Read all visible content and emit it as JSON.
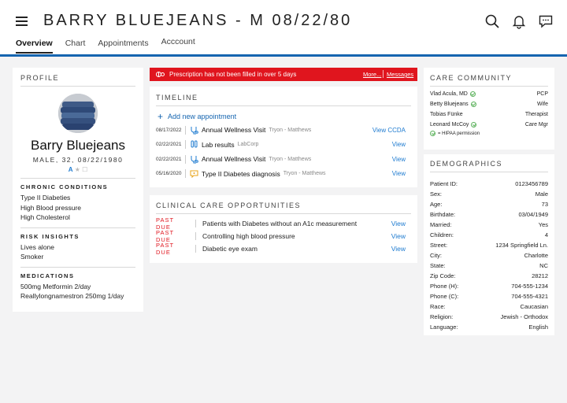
{
  "header": {
    "title": "BARRY BLUEJEANS - M 08/22/80",
    "tabs": [
      {
        "label": "Overview"
      },
      {
        "label": "Chart"
      },
      {
        "label": "Appointments"
      },
      {
        "label": "Acccount"
      }
    ],
    "icons": [
      "search-icon",
      "bell-icon",
      "chat-icon"
    ]
  },
  "profile": {
    "section_title": "PROFILE",
    "name": "Barry Bluejeans",
    "info": "MALE, 32, 08/22/1980",
    "badges": [
      "A",
      "★",
      "☐"
    ],
    "chronic": {
      "title": "CHRONIC CONDITIONS",
      "items": [
        "Type II Diabeties",
        "High Blood pressure",
        "High Cholesterol"
      ]
    },
    "risk": {
      "title": "RISK INSIGHTS",
      "items": [
        "Lives alone",
        "Smoker"
      ]
    },
    "meds": {
      "title": "MEDICATIONS",
      "items": [
        "500mg Metformin 2/day",
        "Reallylongnamestron 250mg 1/day"
      ]
    }
  },
  "alert": {
    "text": "Prescription has not been filled in over 5 days",
    "more": "More...",
    "messages": "Messages",
    "color": "#e0151e"
  },
  "timeline": {
    "title": "TIMELINE",
    "add_label": "Add new appointment",
    "rows": [
      {
        "date": "08/17/2022",
        "icon": "stethoscope-icon",
        "title": "Annual Wellness Visit",
        "sub": "Tryon - Matthews",
        "action": "View CCDA"
      },
      {
        "date": "02/22/2021",
        "icon": "lab-tubes-icon",
        "title": "Lab results",
        "sub": "LabCorp",
        "action": "View"
      },
      {
        "date": "02/22/2021",
        "icon": "stethoscope-icon",
        "title": "Annual Wellness Visit",
        "sub": "Tryon - Matthews",
        "action": "View"
      },
      {
        "date": "05/16/2020",
        "icon": "diagnosis-bubble-icon",
        "title": "Type II Diabetes diagnosis",
        "sub": "Tryon - Matthews",
        "action": "View"
      }
    ]
  },
  "clinical": {
    "title": "CLINICAL CARE OPPORTUNITIES",
    "rows": [
      {
        "status": "PAST DUE",
        "text": "Patients with Diabetes without an A1c measurement",
        "action": "View"
      },
      {
        "status": "PAST DUE",
        "text": "Controlling high blood pressure",
        "action": "View"
      },
      {
        "status": "PAST DUE",
        "text": "Diabetic eye exam",
        "action": "View"
      }
    ]
  },
  "care": {
    "title": "CARE COMMUNITY",
    "rows": [
      {
        "name": "Vlad Acula, MD",
        "role": "PCP",
        "hipaa": true
      },
      {
        "name": "Betty Bluejeans",
        "role": "Wife",
        "hipaa": true
      },
      {
        "name": "Tobias Fünke",
        "role": "Therapist",
        "hipaa": false
      },
      {
        "name": "Leonard McCoy",
        "role": "Care Mgr",
        "hipaa": true
      }
    ],
    "legend": "= HIPAA permission"
  },
  "demographics": {
    "title": "DEMOGRAPHICS",
    "rows": [
      {
        "label": "Patient ID:",
        "value": "0123456789"
      },
      {
        "label": "Sex:",
        "value": "Male"
      },
      {
        "label": "Age:",
        "value": "73"
      },
      {
        "label": "Birthdate:",
        "value": "03/04/1949"
      },
      {
        "label": "Married:",
        "value": "Yes"
      },
      {
        "label": "Children:",
        "value": "4"
      },
      {
        "label": "Street:",
        "value": "1234 Springfield Ln."
      },
      {
        "label": "City:",
        "value": "Charlotte"
      },
      {
        "label": "State:",
        "value": "NC"
      },
      {
        "label": "Zip Code:",
        "value": "28212"
      },
      {
        "label": "Phone (H):",
        "value": "704-555-1234"
      },
      {
        "label": "Phone (C):",
        "value": "704-555-4321"
      },
      {
        "label": "Race:",
        "value": "Caucasian"
      },
      {
        "label": "Religion:",
        "value": "Jewish - Orthodox"
      },
      {
        "label": "Language:",
        "value": "English"
      }
    ]
  }
}
